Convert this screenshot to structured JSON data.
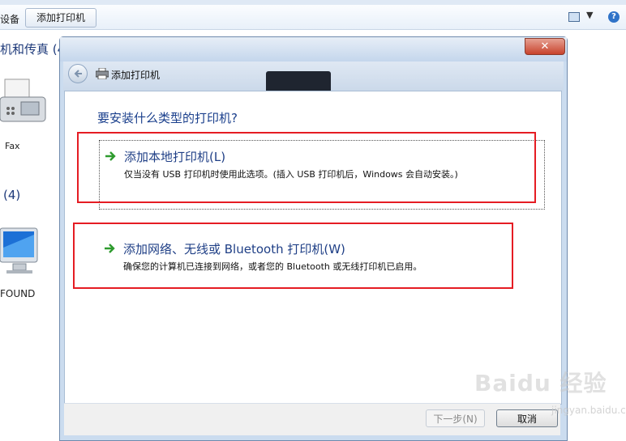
{
  "background": {
    "toolbar": {
      "devices_label": "设备",
      "add_printer_label": "添加打印机"
    },
    "section_printers": "机和传真 (4",
    "section_devices": "(4)",
    "items": [
      {
        "label": "Fax"
      },
      {
        "label": "FOUND"
      }
    ]
  },
  "dialog": {
    "title": "添加打印机",
    "close_label": "✕",
    "question": "要安装什么类型的打印机?",
    "options": [
      {
        "title": "添加本地打印机(L)",
        "description": "仅当没有 USB 打印机时使用此选项。(插入 USB 打印机后，Windows 会自动安装。)"
      },
      {
        "title": "添加网络、无线或 Bluetooth 打印机(W)",
        "description": "确保您的计算机已连接到网络，或者您的 Bluetooth 或无线打印机已启用。"
      }
    ],
    "buttons": {
      "next": "下一步(N)",
      "cancel": "取消"
    }
  },
  "watermark": {
    "text": "Baidu 经验",
    "sub": "jingyan.baidu.com"
  },
  "colors": {
    "annotation": "#e51c23",
    "link_text": "#1f3f86",
    "arrow_green": "#2e9b2e"
  }
}
